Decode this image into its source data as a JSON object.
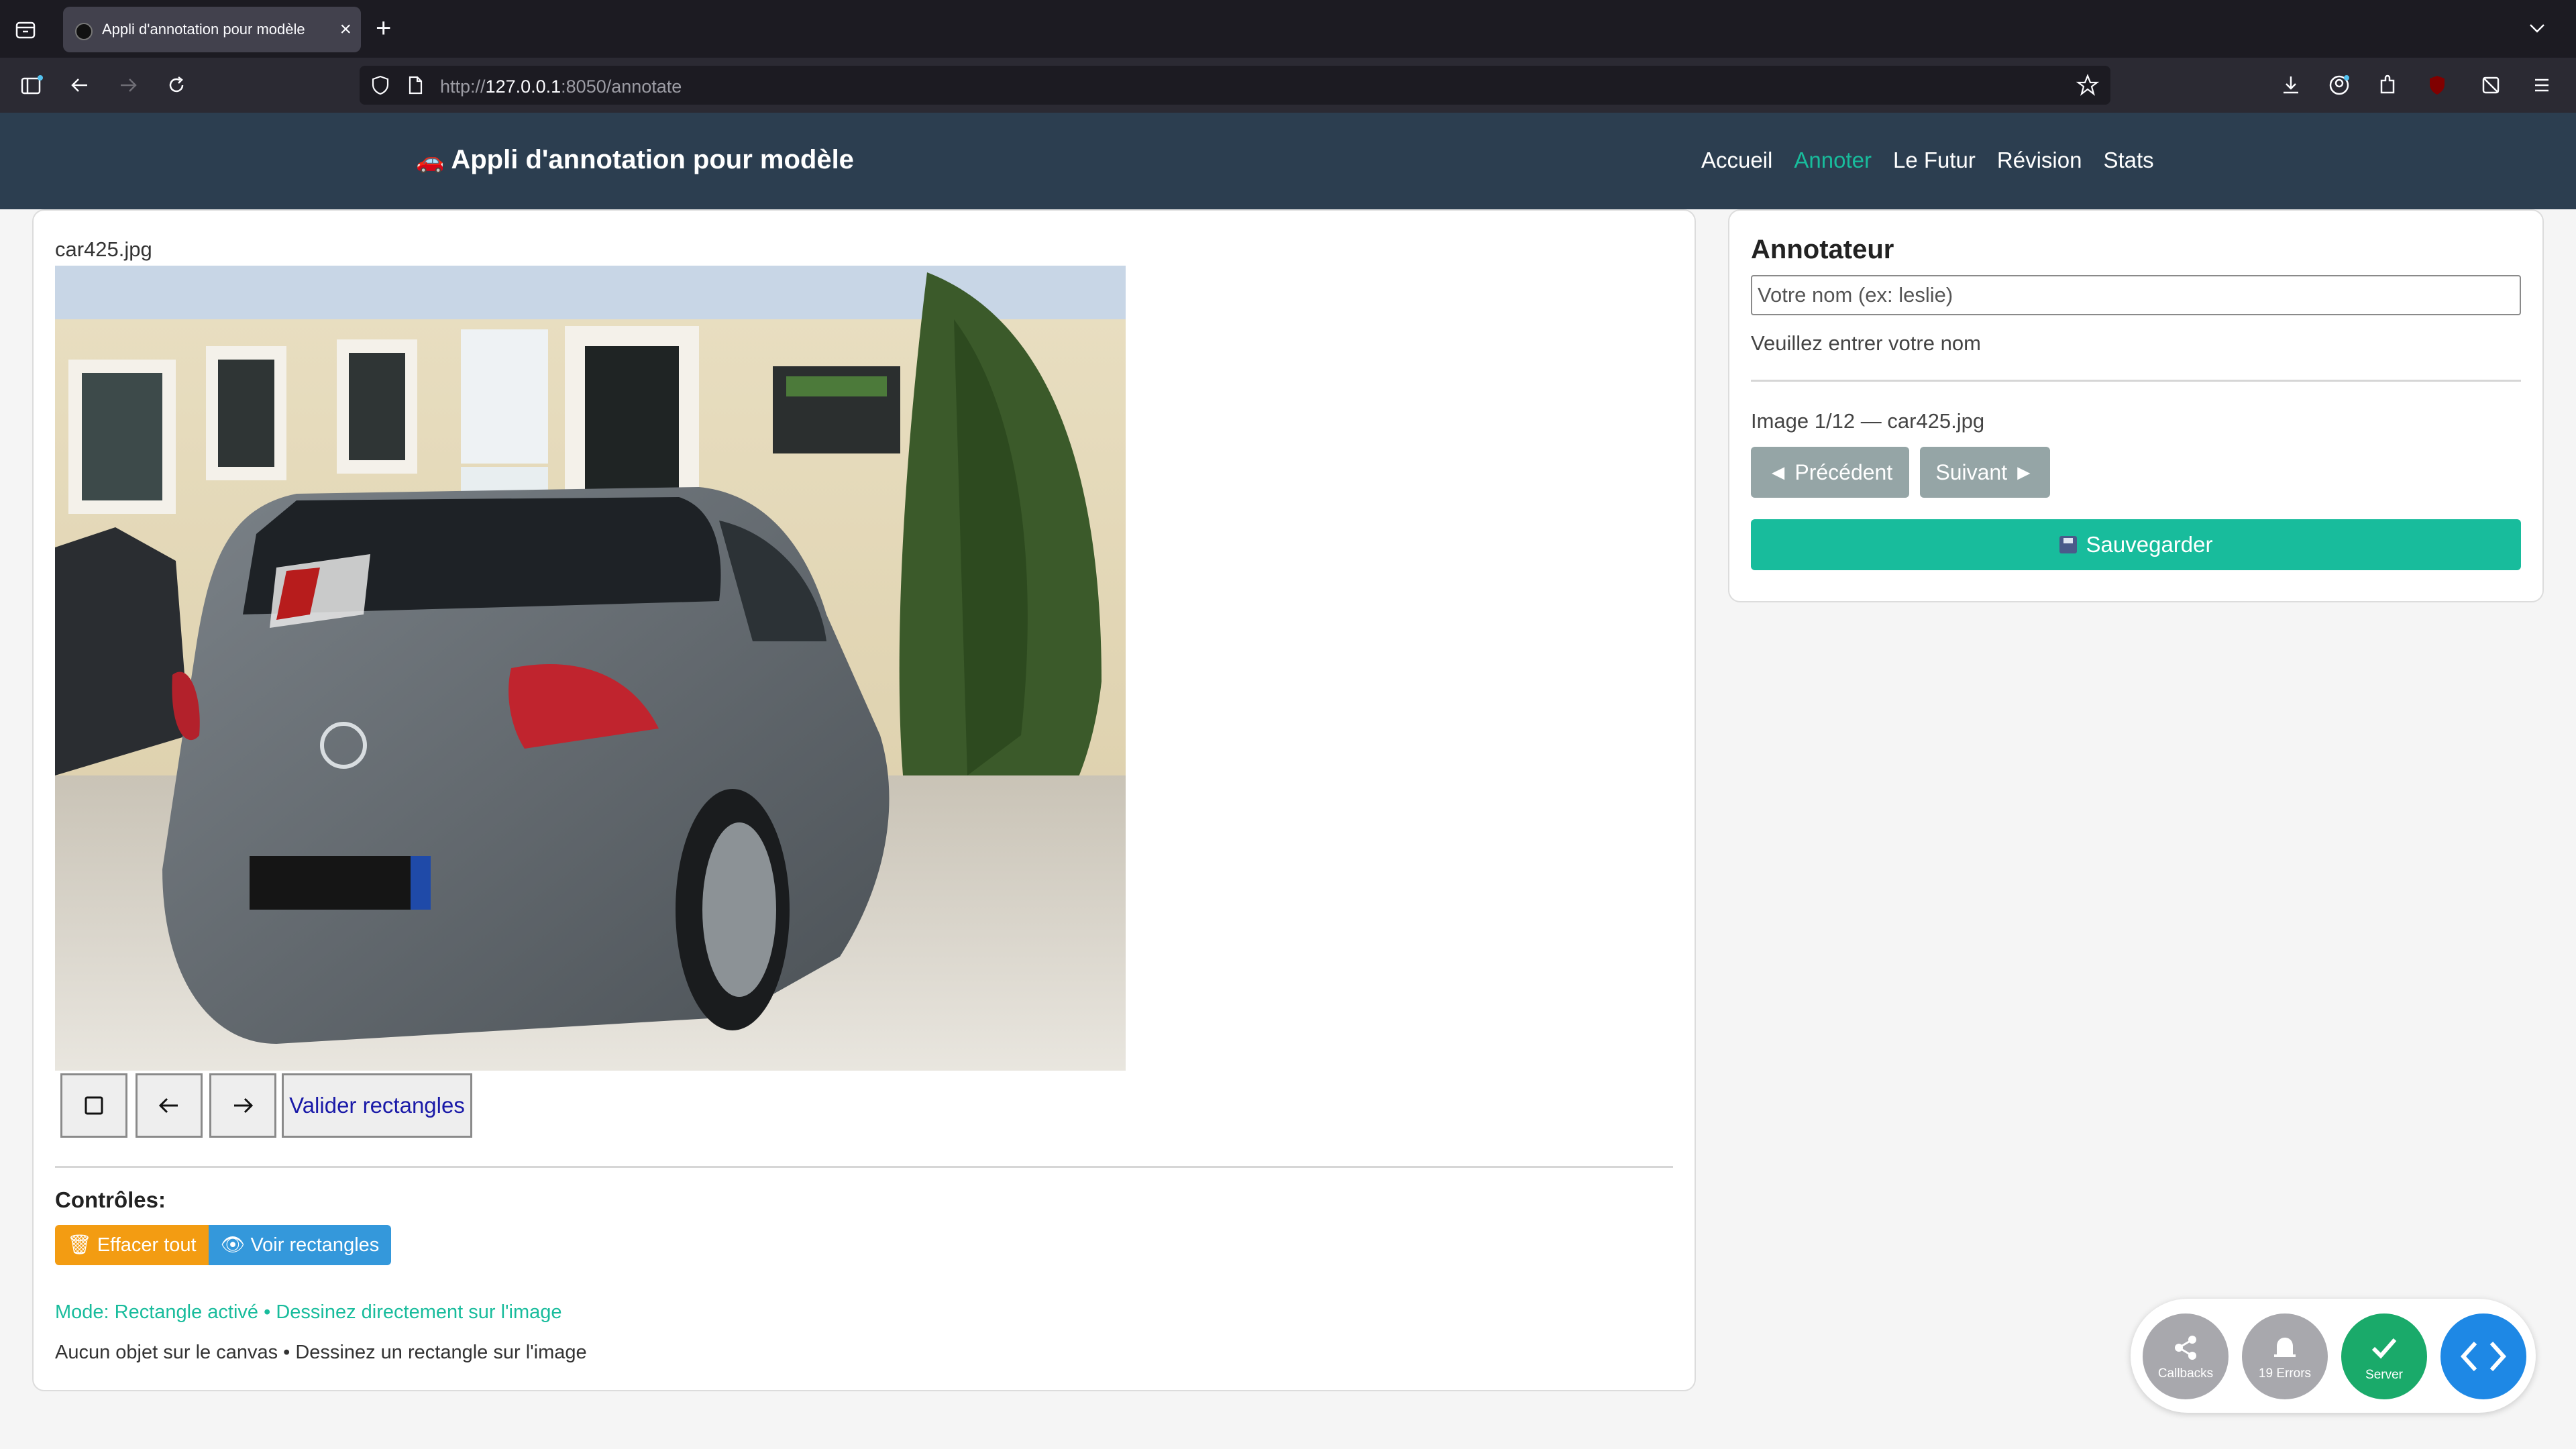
{
  "browser": {
    "tab_title": "Appli d'annotation pour modèle",
    "tab_close": "×",
    "new_tab": "+",
    "url_prefix": "http://",
    "url_host": "127.0.0.1",
    "url_suffix": ":8050/annotate"
  },
  "app": {
    "brand_icon": "🚗",
    "brand": "Appli d'annotation pour modèle",
    "nav": [
      "Accueil",
      "Annoter",
      "Le Futur",
      "Révision",
      "Stats"
    ],
    "active_nav": "Annoter",
    "accent_color": "#18bc9c",
    "navbar_color": "#2c3e50"
  },
  "editor": {
    "filename": "car425.jpg",
    "tools": {
      "square_icon": "square-icon",
      "undo_icon": "arrow-left-icon",
      "redo_icon": "arrow-right-icon",
      "validate_label": "Valider rectangles"
    },
    "controls_label": "Contrôles:",
    "clear_icon": "🗑",
    "clear_label": "Effacer tout",
    "show_icon": "👁",
    "show_label": "Voir rectangles",
    "mode_text": "Mode: Rectangle activé • Dessinez directement sur l'image",
    "status_text": "Aucun objet sur le canvas • Dessinez un rectangle sur l'image"
  },
  "annotator": {
    "title": "Annotateur",
    "input_placeholder": "Votre nom (ex: leslie)",
    "input_value": "",
    "hint": "Veuillez entrer votre nom",
    "counter": "Image 1/12 — car425.jpg",
    "prev_label": "◄ Précédent",
    "next_label": "Suivant ►",
    "save_label": "Sauvegarder"
  },
  "debug": {
    "callbacks": "Callbacks",
    "errors": "19 Errors",
    "server": "Server"
  }
}
